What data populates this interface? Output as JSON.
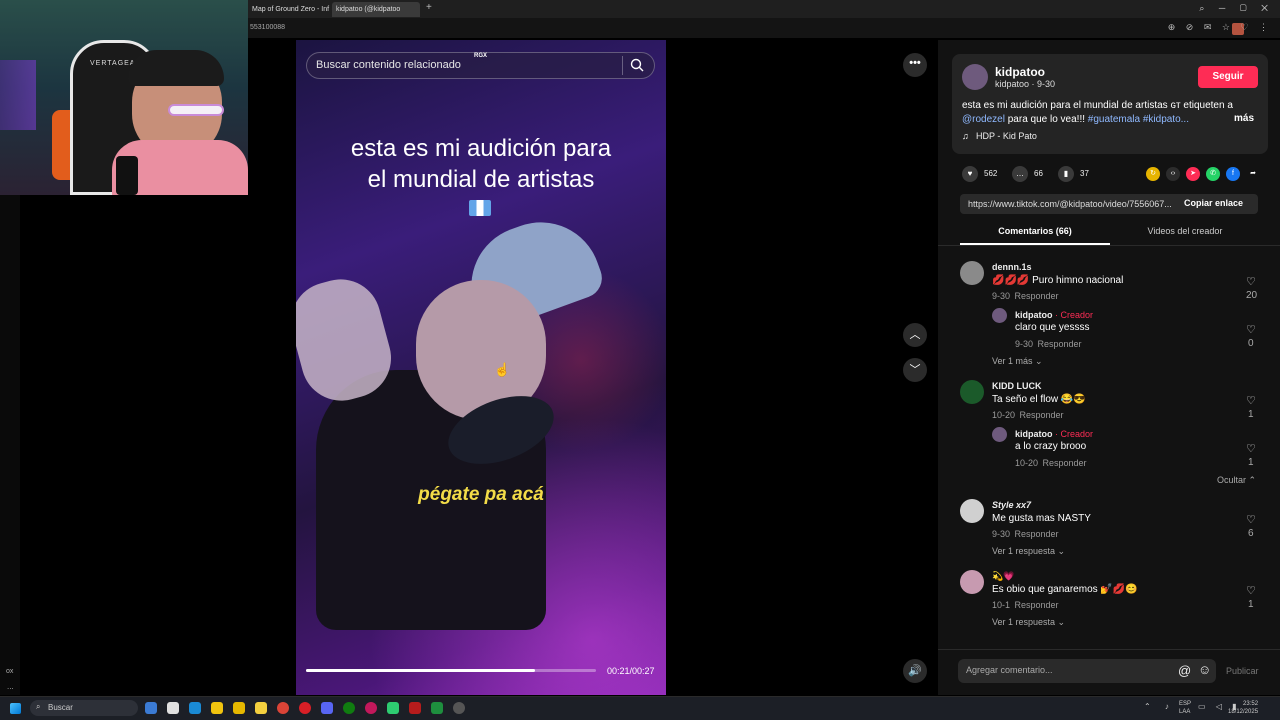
{
  "browser": {
    "tabs": [
      {
        "label": "Map of Ground Zero - Inf"
      },
      {
        "label": "kidpatoo (@kidpatoo"
      }
    ],
    "new_tab_symbol": "+",
    "url_fragment": "553100088"
  },
  "webcam": {
    "chair_brand": "VERTAGEAR"
  },
  "left_panel": {
    "label": "ox",
    "dots": "..."
  },
  "video": {
    "search_placeholder": "Buscar contenido relacionado",
    "rgx_badge": "RGX",
    "caption_line1": "esta es mi audición para",
    "caption_line2": "el mundial de artistas",
    "subtitle": "pégate pa acá",
    "time": "00:21/00:27",
    "progress": 0.79
  },
  "controls": {
    "more": "•••"
  },
  "post": {
    "author": "kidpatoo",
    "author_sub": "kidpatoo · 9-30",
    "follow_label": "Seguir",
    "desc_prefix": "esta es mi audición para el mundial de artistas",
    "desc_gt": "ɢᴛ",
    "desc_mid": "etiqueten a",
    "mention": "@rodezel",
    "desc_after": "para que lo vea!!!",
    "tag1": "#guatemala",
    "tag2": "#kidpato...",
    "more_label": "más",
    "music": "HDP - Kid Pato",
    "likes": "562",
    "comments": "66",
    "saves": "37",
    "link": "https://www.tiktok.com/@kidpatoo/video/7556067...",
    "copy_label": "Copiar enlace",
    "tab_comments": "Comentarios (66)",
    "tab_videos": "Videos del creador"
  },
  "comments": [
    {
      "name": "dennn.1s",
      "text": "💋💋💋 Puro himno nacional",
      "meta": "9-30 Responder",
      "likes": "20"
    },
    {
      "name": "kidpatoo",
      "creator": "· Creador",
      "text": "claro que yessss",
      "meta": "9-30 Responder",
      "likes": "0"
    },
    {
      "more": "Ver 1 más"
    },
    {
      "name": "KIDD LUCK",
      "text": "Ta seño el flow 😂😎",
      "meta": "10-20 Responder",
      "likes": "1"
    },
    {
      "name": "kidpatoo",
      "creator": "· Creador",
      "text": "a lo crazy brooo",
      "meta": "10-20 Responder",
      "likes": "1"
    },
    {
      "more": "Ocultar"
    },
    {
      "name": "Style xx7",
      "text": "Me gusta mas NASTY",
      "meta": "9-30 Responder",
      "likes": "6"
    },
    {
      "more": "Ver 1 respuesta"
    },
    {
      "name": "💫💗",
      "text": "Es obio que ganaremos 💅💋😊",
      "meta": "10-1 Responder",
      "likes": "1"
    },
    {
      "more": "Ver 1 respuesta"
    }
  ],
  "comment_bar": {
    "placeholder": "Agregar comentario...",
    "post_label": "Publicar"
  },
  "taskbar": {
    "search": "Buscar",
    "lang1": "ESP",
    "lang2": "LAA",
    "time": "23:52",
    "date": "18/12/2025"
  }
}
